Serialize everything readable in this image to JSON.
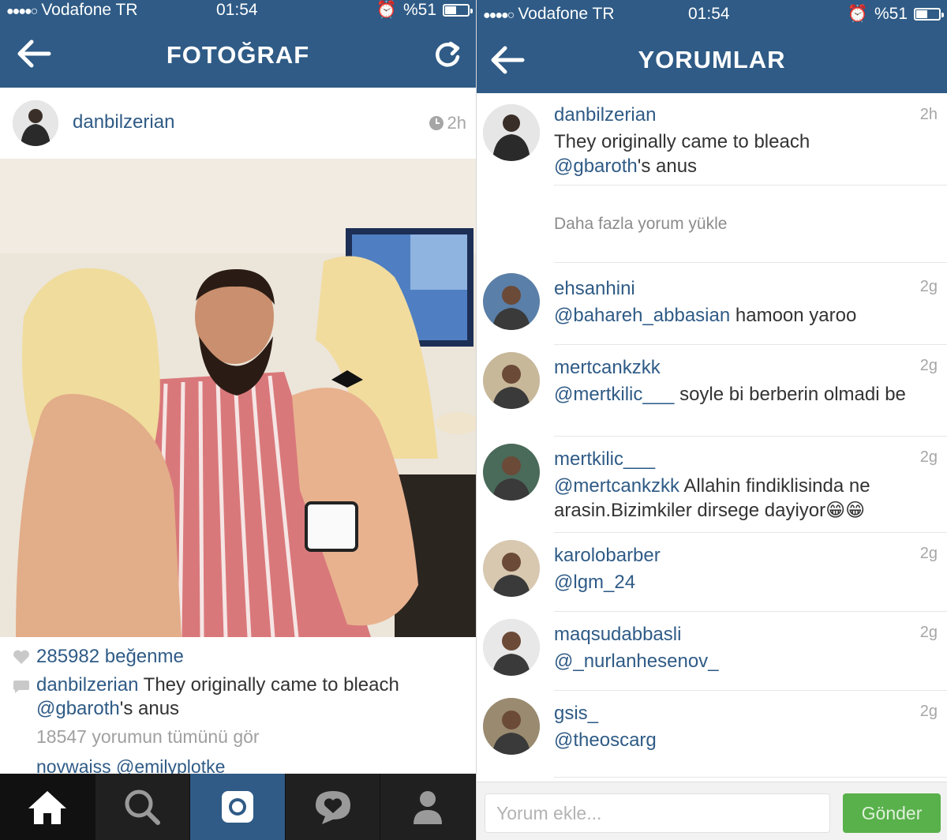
{
  "left": {
    "status": {
      "carrier": "Vodafone TR",
      "time": "01:54",
      "battery": "%51",
      "battery_level": 0.51
    },
    "header": {
      "title": "FOTOĞRAF"
    },
    "post": {
      "username": "danbilzerian",
      "time_ago": "2h",
      "likes": "285982 beğenme",
      "caption_user": "danbilzerian",
      "caption_text_1": " They originally came to bleach",
      "caption_mention": "@gbaroth",
      "caption_text_2": "'s anus",
      "view_all": "18547 yorumun tümünü gör",
      "partial_comment": "novwaiss @emilyplotke"
    },
    "tabbar": {
      "items": [
        "home-icon",
        "search-icon",
        "camera-icon",
        "activity-icon",
        "profile-icon"
      ]
    }
  },
  "right": {
    "status": {
      "carrier": "Vodafone TR",
      "time": "01:54",
      "battery": "%51",
      "battery_level": 0.51
    },
    "header": {
      "title": "YORUMLAR"
    },
    "caption_comment": {
      "user": "danbilzerian",
      "time": "2h",
      "text_1": "They originally came to bleach",
      "mention": "@gbaroth",
      "text_2": "'s anus"
    },
    "load_more": "Daha fazla yorum yükle",
    "comments": [
      {
        "user": "ehsanhini",
        "time": "2g",
        "mention": "@bahareh_abbasian",
        "text": " hamoon yaroo"
      },
      {
        "user": "mertcankzkk",
        "time": "2g",
        "mention": "@mertkilic___",
        "text": " soyle bi berberin olmadi be"
      },
      {
        "user": "mertkilic___",
        "time": "2g",
        "mention": "@mertcankzkk",
        "text": " Allahin findiklisinda ne arasin.Bizimkiler dirsege dayiyor😁😁"
      },
      {
        "user": "karolobarber",
        "time": "2g",
        "mention": "@lgm_24",
        "text": ""
      },
      {
        "user": "maqsudabbasli",
        "time": "2g",
        "mention": "@_nurlanhesenov_",
        "text": ""
      },
      {
        "user": "gsis_",
        "time": "2g",
        "mention": "@theoscarg",
        "text": ""
      }
    ],
    "composer": {
      "placeholder": "Yorum ekle...",
      "send_label": "Gönder"
    }
  },
  "colors": {
    "header": "#2f5b86",
    "link": "#2f5b86",
    "send": "#58b14a",
    "tabbar": "#202020"
  }
}
